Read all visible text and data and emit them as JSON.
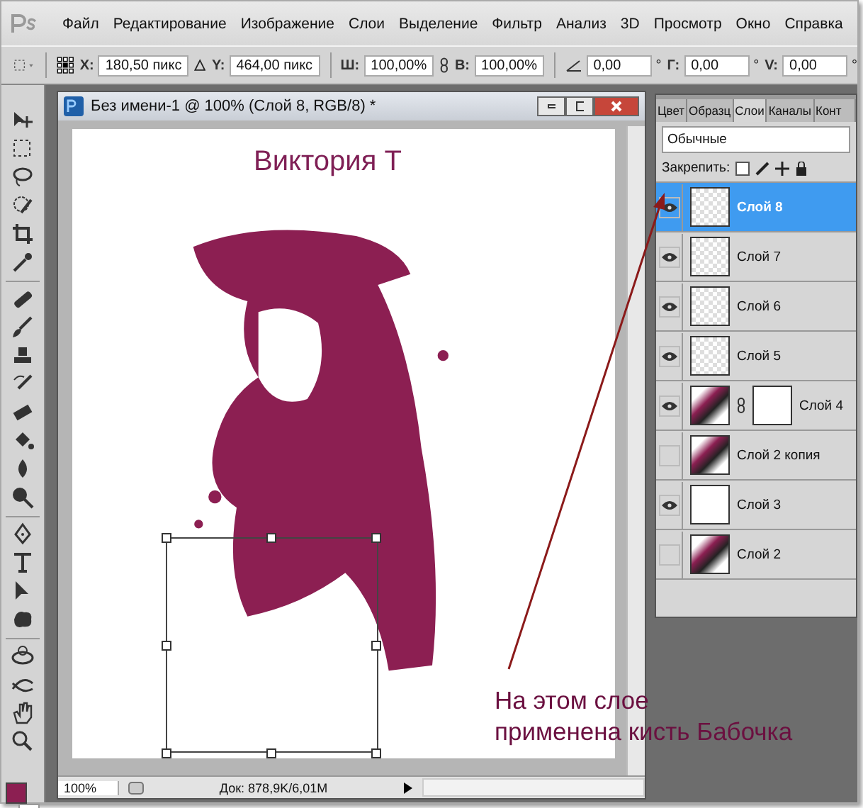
{
  "menu": [
    {
      "label": "Файл"
    },
    {
      "label": "Редактирование"
    },
    {
      "label": "Изображение"
    },
    {
      "label": "Слои"
    },
    {
      "label": "Выделение"
    },
    {
      "label": "Фильтр"
    },
    {
      "label": "Анализ"
    },
    {
      "label": "3D"
    },
    {
      "label": "Просмотр"
    },
    {
      "label": "Окно"
    },
    {
      "label": "Справка"
    }
  ],
  "options": [
    {
      "kind": "field",
      "label": "X:",
      "value": "180,50 пикс"
    },
    {
      "kind": "delta"
    },
    {
      "kind": "field",
      "label": "Y:",
      "value": "464,00 пикс"
    },
    {
      "kind": "sep"
    },
    {
      "kind": "field",
      "label": "Ш:",
      "value": "100,00%"
    },
    {
      "kind": "link"
    },
    {
      "kind": "field",
      "label": "В:",
      "value": "100,00%"
    },
    {
      "kind": "sep"
    },
    {
      "kind": "angle",
      "value": "0,00",
      "unit": "°"
    },
    {
      "kind": "field",
      "label": "Г:",
      "value": "0,00",
      "unit": "°"
    },
    {
      "kind": "field",
      "label": "V:",
      "value": "0,00",
      "unit": "°"
    }
  ],
  "foreground_swatch": {
    "color": "#8c1f52"
  },
  "document": {
    "title": "Без имени-1 @ 100% (Слой 8, RGB/8) *",
    "canvas_text": "Виктория Т",
    "zoom": "100%",
    "doc_info": "Док: 878,9K/6,01M"
  },
  "layers_panel": {
    "tabs": [
      {
        "label": "Цвет",
        "selected": false
      },
      {
        "label": "Образц",
        "selected": false
      },
      {
        "label": "Слои",
        "selected": true
      },
      {
        "label": "Каналы",
        "selected": false
      },
      {
        "label": "Конт",
        "selected": false
      }
    ],
    "blend_mode": "Обычные",
    "lock_label": "Закрепить:",
    "layers": [
      {
        "name": "Слой 8",
        "visible": true,
        "selected": true,
        "kind": "transparent",
        "mask": false
      },
      {
        "name": "Слой 7",
        "visible": true,
        "selected": false,
        "kind": "transparent",
        "mask": false
      },
      {
        "name": "Слой 6",
        "visible": true,
        "selected": false,
        "kind": "transparent",
        "mask": false
      },
      {
        "name": "Слой 5",
        "visible": true,
        "selected": false,
        "kind": "transparent",
        "mask": false
      },
      {
        "name": "Слой 4",
        "visible": true,
        "selected": false,
        "kind": "image",
        "mask": true
      },
      {
        "name": "Слой 2 копия",
        "visible": false,
        "selected": false,
        "kind": "image",
        "mask": false
      },
      {
        "name": "Слой 3",
        "visible": true,
        "selected": false,
        "kind": "white",
        "mask": false
      },
      {
        "name": "Слой 2",
        "visible": false,
        "selected": false,
        "kind": "image",
        "mask": false
      }
    ]
  },
  "annotation": "На этом слое\nприменена кисть Бабочка"
}
